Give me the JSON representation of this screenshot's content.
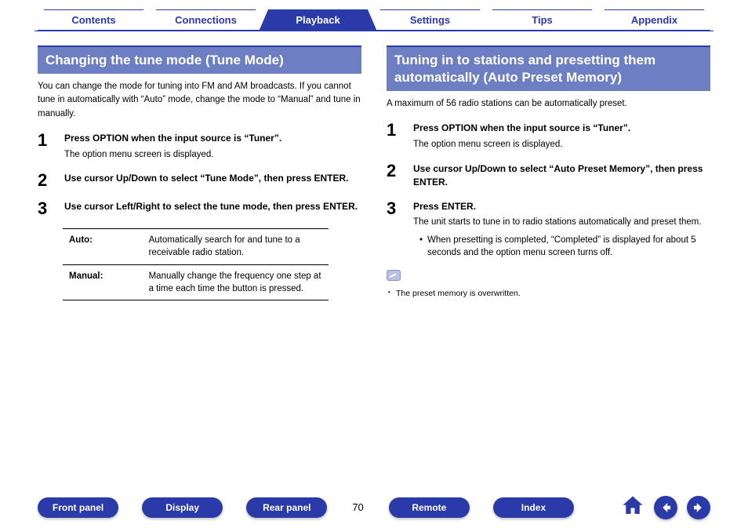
{
  "nav_tabs": {
    "contents": "Contents",
    "connections": "Connections",
    "playback": "Playback",
    "settings": "Settings",
    "tips": "Tips",
    "appendix": "Appendix",
    "active": "playback"
  },
  "left": {
    "title": "Changing the tune mode (Tune Mode)",
    "intro": "You can change the mode for tuning into FM and AM broadcasts. If you cannot tune in automatically with “Auto” mode, change the mode to “Manual” and tune in manually.",
    "steps": [
      {
        "num": "1",
        "head": "Press OPTION when the input source is “Tuner”.",
        "sub": "The option menu screen is displayed."
      },
      {
        "num": "2",
        "head": "Use cursor Up/Down to select “Tune Mode”, then press ENTER."
      },
      {
        "num": "3",
        "head": "Use cursor Left/Right to select the tune mode, then press ENTER."
      }
    ],
    "modes": [
      {
        "key": "Auto:",
        "desc": "Automatically search for and tune to a receivable radio station."
      },
      {
        "key": "Manual:",
        "desc": "Manually change the frequency one step at a time each time the button is pressed."
      }
    ]
  },
  "right": {
    "title": "Tuning in to stations and presetting them automatically (Auto Preset Memory)",
    "intro": "A maximum of 56 radio stations can be automatically preset.",
    "steps": [
      {
        "num": "1",
        "head": "Press OPTION when the input source is “Tuner”.",
        "sub": "The option menu screen is displayed."
      },
      {
        "num": "2",
        "head": "Use cursor Up/Down to select “Auto Preset Memory”, then press ENTER."
      },
      {
        "num": "3",
        "head": "Press ENTER.",
        "sub": "The unit starts to tune in to radio stations automatically and preset them.",
        "bullet": "When presetting is completed, “Completed” is displayed for about 5 seconds and the option menu screen turns off."
      }
    ],
    "note": "The preset memory is overwritten."
  },
  "bottom": {
    "front_panel": "Front panel",
    "display": "Display",
    "rear_panel": "Rear panel",
    "page": "70",
    "remote": "Remote",
    "index": "Index"
  }
}
